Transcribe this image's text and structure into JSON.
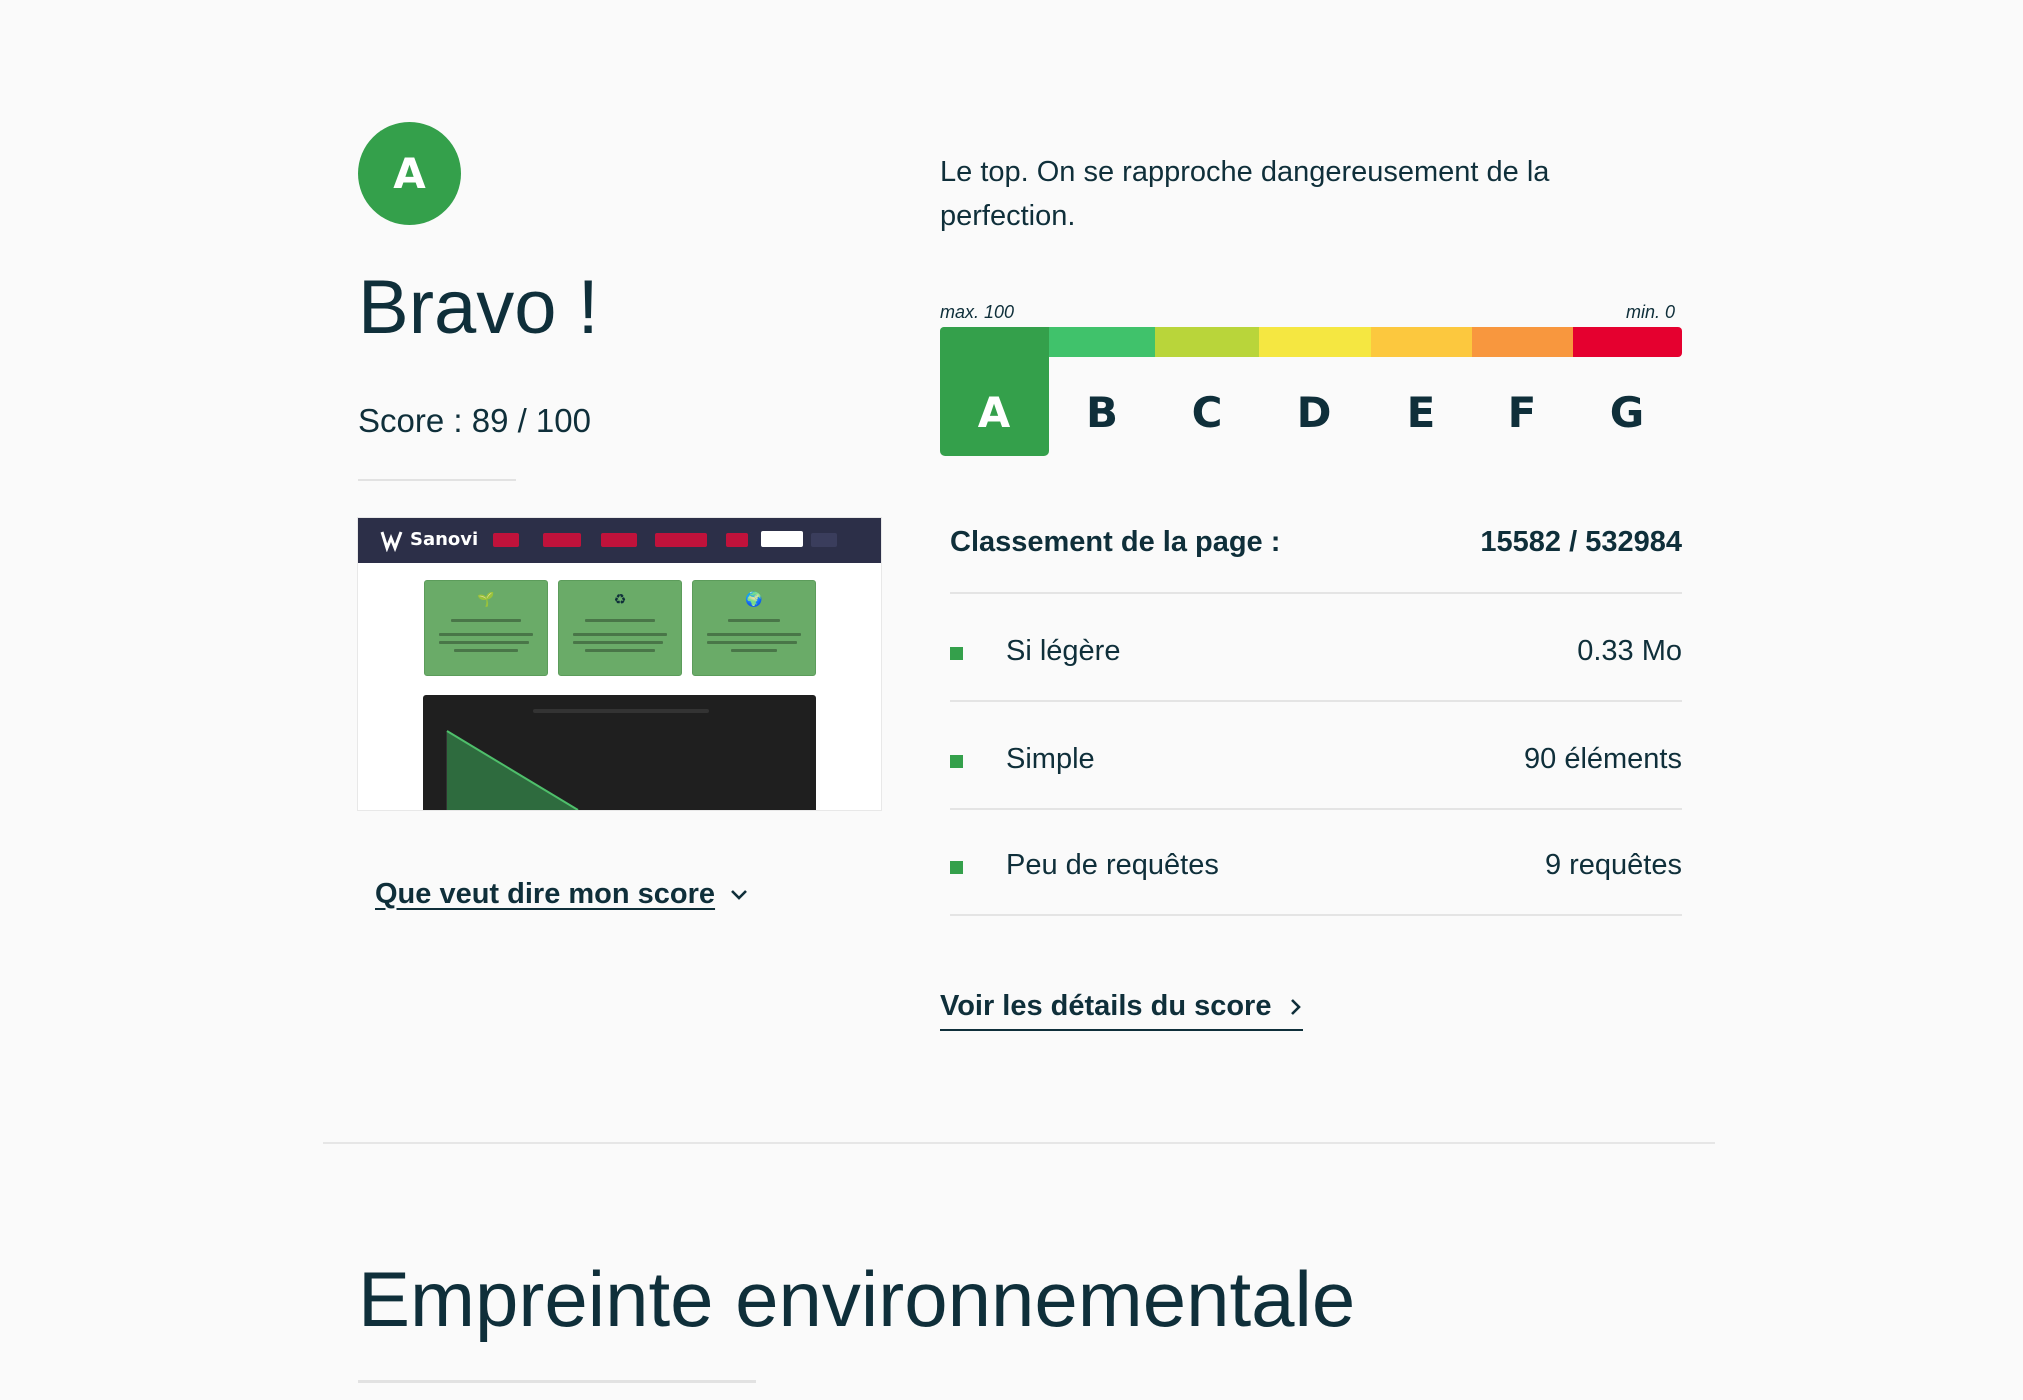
{
  "result": {
    "grade": "A",
    "headline": "Bravo !",
    "score_text": "Score : 89 / 100",
    "tagline": "Le top. On se rapproche dangereusement de la perfection.",
    "score_link": "Que veut dire mon score",
    "details_link": "Voir les détails du score"
  },
  "scale": {
    "max_label": "max. 100",
    "min_label": "min. 0",
    "grades": [
      "A",
      "B",
      "C",
      "D",
      "E",
      "F",
      "G"
    ],
    "active": "A",
    "colors": [
      "#34a04b",
      "#40c26b",
      "#b9d53a",
      "#f5e741",
      "#fcc83e",
      "#f8973e",
      "#e5002f"
    ]
  },
  "ranking": {
    "label": "Classement de la page :",
    "value": "15582 / 532984"
  },
  "metrics": [
    {
      "label": "Si légère",
      "value": "0.33 Mo"
    },
    {
      "label": "Simple",
      "value": "90 éléments"
    },
    {
      "label": "Peu de requêtes",
      "value": "9 requêtes"
    }
  ],
  "thumbnail": {
    "site_name": "Sanovi"
  },
  "section": {
    "title": "Empreinte environnementale"
  },
  "icons": {
    "score_link_icon": "chevron-down-icon",
    "details_link_icon": "chevron-right-icon",
    "metric_bullet": "square-bullet-icon"
  }
}
